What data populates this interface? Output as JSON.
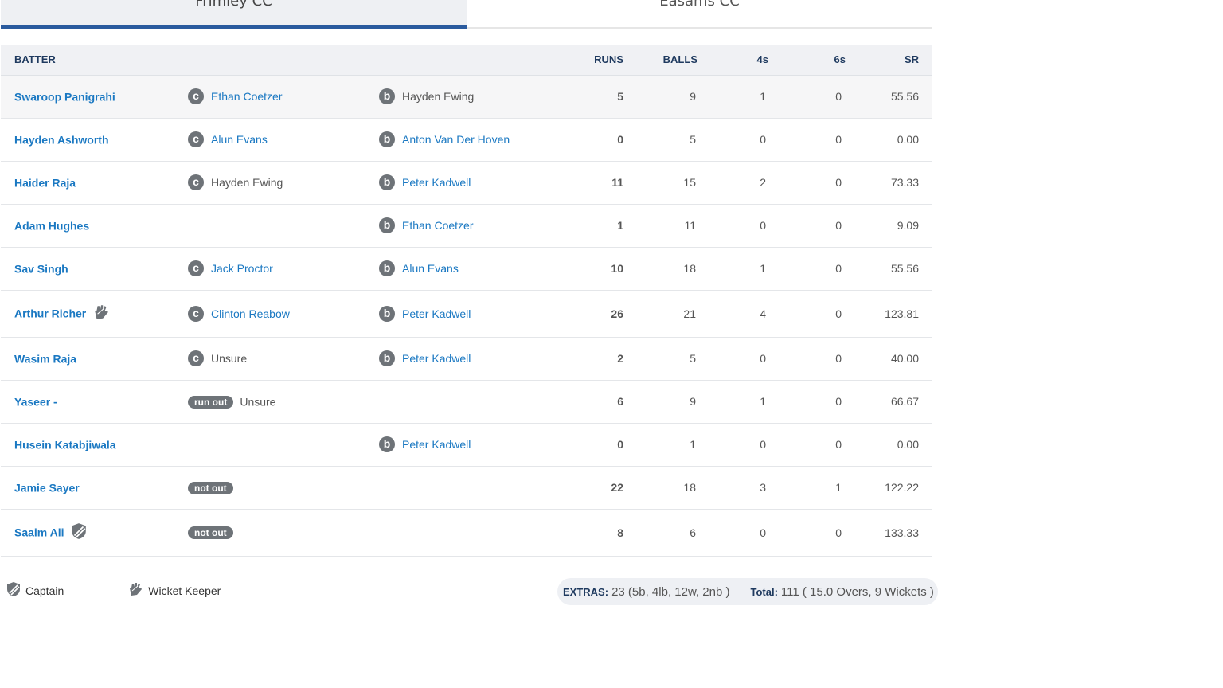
{
  "tabs": [
    {
      "label": "Frimley CC",
      "active": true
    },
    {
      "label": "Easams CC",
      "active": false
    }
  ],
  "table": {
    "headers": {
      "batter": "BATTER",
      "runs": "RUNS",
      "balls": "BALLS",
      "fours": "4s",
      "sixes": "6s",
      "sr": "SR"
    },
    "rows": [
      {
        "batter": "Swaroop Panigrahi",
        "how": "c",
        "fielder": "Ethan Coetzer",
        "bowled_tag": "b",
        "bowler": "Hayden Ewing",
        "runs": "5",
        "balls": "9",
        "fours": "1",
        "sixes": "0",
        "sr": "55.56"
      },
      {
        "batter": "Hayden Ashworth",
        "how": "c",
        "fielder": "Alun Evans",
        "bowled_tag": "b",
        "bowler": "Anton Van Der Hoven",
        "runs": "0",
        "balls": "5",
        "fours": "0",
        "sixes": "0",
        "sr": "0.00"
      },
      {
        "batter": "Haider Raja",
        "how": "c",
        "fielder": "Hayden Ewing",
        "bowled_tag": "b",
        "bowler": "Peter Kadwell",
        "runs": "11",
        "balls": "15",
        "fours": "2",
        "sixes": "0",
        "sr": "73.33"
      },
      {
        "batter": "Adam Hughes",
        "bowled_tag": "b",
        "bowler": "Ethan Coetzer",
        "runs": "1",
        "balls": "11",
        "fours": "0",
        "sixes": "0",
        "sr": "9.09"
      },
      {
        "batter": "Sav Singh",
        "how": "c",
        "fielder": "Jack Proctor",
        "bowled_tag": "b",
        "bowler": "Alun Evans",
        "runs": "10",
        "balls": "18",
        "fours": "1",
        "sixes": "0",
        "sr": "55.56"
      },
      {
        "batter": "Arthur Richer",
        "how": "c",
        "fielder": "Clinton Reabow",
        "bowled_tag": "b",
        "bowler": "Peter Kadwell",
        "runs": "26",
        "balls": "21",
        "fours": "4",
        "sixes": "0",
        "sr": "123.81"
      },
      {
        "batter": "Wasim Raja",
        "how": "c",
        "fielder": "Unsure",
        "bowled_tag": "b",
        "bowler": "Peter Kadwell",
        "runs": "2",
        "balls": "5",
        "fours": "0",
        "sixes": "0",
        "sr": "40.00"
      },
      {
        "batter": "Yaseer -",
        "how_pill": "run out",
        "fielder": "Unsure",
        "runs": "6",
        "balls": "9",
        "fours": "1",
        "sixes": "0",
        "sr": "66.67"
      },
      {
        "batter": "Husein Katabjiwala",
        "bowled_tag": "b",
        "bowler": "Peter Kadwell",
        "runs": "0",
        "balls": "1",
        "fours": "0",
        "sixes": "0",
        "sr": "0.00"
      },
      {
        "batter": "Jamie Sayer",
        "how_pill": "not out",
        "runs": "22",
        "balls": "18",
        "fours": "3",
        "sixes": "1",
        "sr": "122.22"
      },
      {
        "batter": "Saaim Ali",
        "how_pill": "not out",
        "runs": "8",
        "balls": "6",
        "fours": "0",
        "sixes": "0",
        "sr": "133.33"
      }
    ]
  },
  "legend": {
    "captain": "Captain",
    "keeper": "Wicket Keeper"
  },
  "summary": {
    "extras_label": "EXTRAS:",
    "extras_value": "23 (5b, 4lb, 12w, 2nb )",
    "total_label": "Total:",
    "total_value": "111 ( 15.0 Overs, 9 Wickets )"
  },
  "icons": {
    "captain": "shield-icon",
    "keeper": "glove-icon"
  },
  "colors": {
    "link": "#1a78c2",
    "tab_active": "#2a5b9e",
    "badge": "#6e7378",
    "header": "#1f3a5f"
  }
}
